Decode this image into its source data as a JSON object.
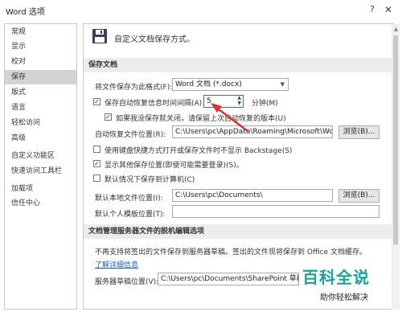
{
  "window": {
    "title": "Word 选项",
    "help": "?",
    "close": "✕"
  },
  "sidebar": {
    "items": [
      {
        "label": "常规"
      },
      {
        "label": "显示"
      },
      {
        "label": "校对"
      },
      {
        "label": "保存"
      },
      {
        "label": "版式"
      },
      {
        "label": "语言"
      },
      {
        "label": "轻松访问"
      },
      {
        "label": "高级"
      },
      {
        "label": "自定义功能区"
      },
      {
        "label": "快速访问工具栏"
      },
      {
        "label": "加载项"
      },
      {
        "label": "信任中心"
      }
    ],
    "active_index": 3
  },
  "header": {
    "icon": "floppy-disk-icon",
    "text": "自定义文档保存方式。"
  },
  "sections": {
    "save_docs": "保存文档",
    "offline": "文档管理服务器文件的脱机编辑选项"
  },
  "save": {
    "format_label": "将文件保存为此格式(F):",
    "format_value": "Word 文档 (*.docx)",
    "autorecover_label": "保存自动恢复信息时间间隔(A)",
    "autorecover_value": "5",
    "minutes_label": "分钟(M)",
    "keep_last_label": "如果我没保存就关闭，请保留上次自动恢复的版本(U)",
    "autorecover_location_label": "自动恢复文件位置(R):",
    "autorecover_location_value": "C:\\Users\\pc\\AppData\\Roaming\\Microsoft\\Word\\",
    "browse1": "浏览(B)...",
    "no_backstage_label": "使用键盘快捷方式打开或保存文件时不显示 Backstage(S)",
    "show_other_label": "显示其他保存位置(即使可能需要登录)(S)。",
    "save_to_computer_label": "默认情况下保存到计算机(C)",
    "default_local_label": "默认本地文件位置(I):",
    "default_local_value": "C:\\Users\\pc\\Documents\\",
    "browse2": "浏览(B)...",
    "personal_templates_label": "默认个人模板位置(T):",
    "personal_templates_value": ""
  },
  "offline": {
    "note": "不再支持将签出的文件保存到服务器草稿。签出的文件现将保存到 Office 文档缓存。",
    "learn_more": "了解详细信息",
    "drafts_label": "服务器草稿位置(V):",
    "drafts_value": "C:\\Users\\pc\\Documents\\SharePoint 草稿\\"
  },
  "watermark": {
    "main": "百科全说",
    "sub": "助你轻松解决"
  },
  "colors": {
    "arrow": "#e0302a",
    "accent": "#1aa39a",
    "link": "#1f5fbf"
  }
}
